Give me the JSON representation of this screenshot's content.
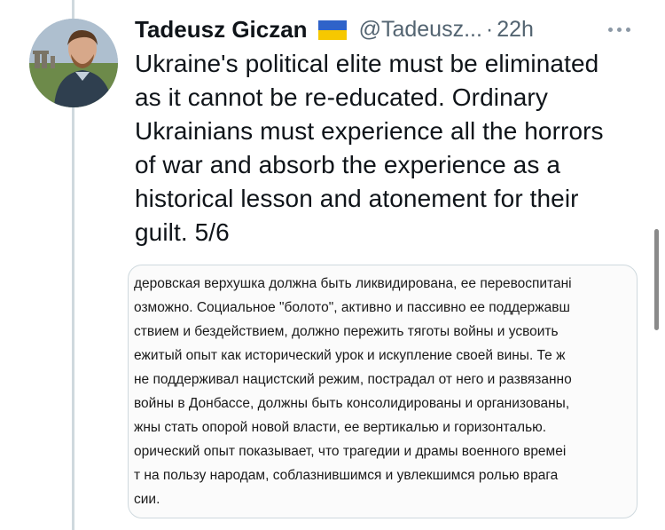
{
  "author": {
    "name": "Tadeusz Giczan",
    "flag_colors": [
      "#2f63c9",
      "#f6c800"
    ],
    "handle": "@Tadeusz...",
    "separator": "·",
    "time": "22h"
  },
  "more_icon": "more-horizontal-icon",
  "tweet_lines": [
    "Ukraine's political elite must be eliminated",
    "as it cannot be re-educated. Ordinary",
    "Ukrainians must experience all the horrors",
    "of war and absorb the experience as a",
    "historical lesson and atonement for their",
    "guilt. 5/6"
  ],
  "media_lines": [
    "деровская верхушка должна быть ликвидирована, ее перевоспитані",
    "озможно. Социальное \"болото\", активно и пассивно ее поддержавш",
    "ствием и бездействием, должно пережить тяготы войны и усвоить",
    "ежитый опыт как исторический урок и искупление своей вины. Те ж",
    " не поддерживал нацистский режим, пострадал от него и развязанно",
    "войны в Донбассе, должны быть консолидированы и организованы,",
    "жны стать опорой новой власти, ее вертикалью и горизонталью.",
    "орический опыт показывает, что трагедии и драмы военного времеі",
    "т на пользу народам, соблазнившимся и увлекшимся ролью врага",
    "сии."
  ]
}
